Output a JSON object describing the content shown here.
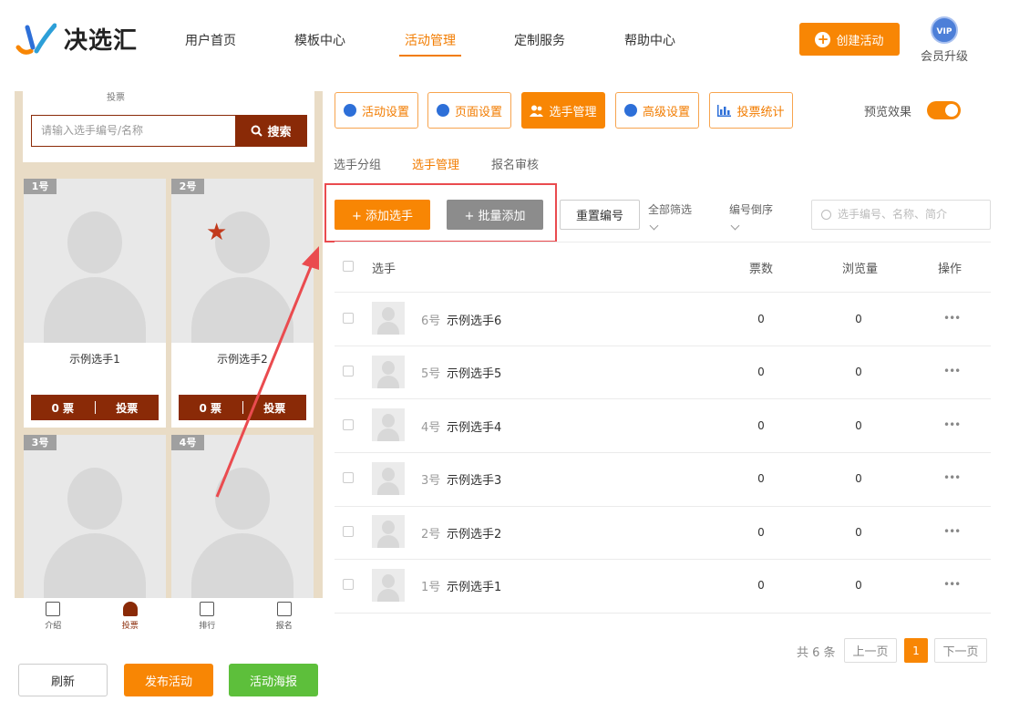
{
  "nav": {
    "brand": "决选汇",
    "menu": [
      "用户首页",
      "模板中心",
      "活动管理",
      "定制服务",
      "帮助中心"
    ],
    "create_label": "创建活动",
    "vip_badge": "VIP",
    "vip_label": "会员升级"
  },
  "preview": {
    "top_text": "投票",
    "search_placeholder": "请输入选手编号/名称",
    "search_button": "搜索",
    "cards": [
      {
        "num": "1号",
        "name": "示例选手1",
        "votes": "0 票",
        "vote_label": "投票"
      },
      {
        "num": "2号",
        "name": "示例选手2",
        "votes": "0 票",
        "vote_label": "投票"
      },
      {
        "num": "3号"
      },
      {
        "num": "4号"
      }
    ],
    "tabs": [
      "介绍",
      "投票",
      "排行",
      "报名"
    ]
  },
  "actions": {
    "refresh": "刷新",
    "publish": "发布活动",
    "poster": "活动海报"
  },
  "toolbar": {
    "buttons": [
      "活动设置",
      "页面设置",
      "选手管理",
      "高级设置",
      "投票统计"
    ],
    "preview_label": "预览效果"
  },
  "subtabs": [
    "选手分组",
    "选手管理",
    "报名审核"
  ],
  "controls": {
    "add": "+ 添加选手",
    "batch_add": "+ 批量添加",
    "reset": "重置编号",
    "filter": "全部筛选",
    "sort": "编号倒序",
    "search_placeholder": "选手编号、名称、简介"
  },
  "table": {
    "headers": {
      "player": "选手",
      "votes": "票数",
      "views": "浏览量",
      "ops": "操作"
    },
    "rows": [
      {
        "num": "6号",
        "name": "示例选手6",
        "votes": "0",
        "views": "0",
        "more": "•••"
      },
      {
        "num": "5号",
        "name": "示例选手5",
        "votes": "0",
        "views": "0",
        "more": "•••"
      },
      {
        "num": "4号",
        "name": "示例选手4",
        "votes": "0",
        "views": "0",
        "more": "•••"
      },
      {
        "num": "3号",
        "name": "示例选手3",
        "votes": "0",
        "views": "0",
        "more": "•••"
      },
      {
        "num": "2号",
        "name": "示例选手2",
        "votes": "0",
        "views": "0",
        "more": "•••"
      },
      {
        "num": "1号",
        "name": "示例选手1",
        "votes": "0",
        "views": "0",
        "more": "•••"
      }
    ]
  },
  "pagination": {
    "total": "共 6 条",
    "prev": "上一页",
    "current": "1",
    "next": "下一页"
  }
}
